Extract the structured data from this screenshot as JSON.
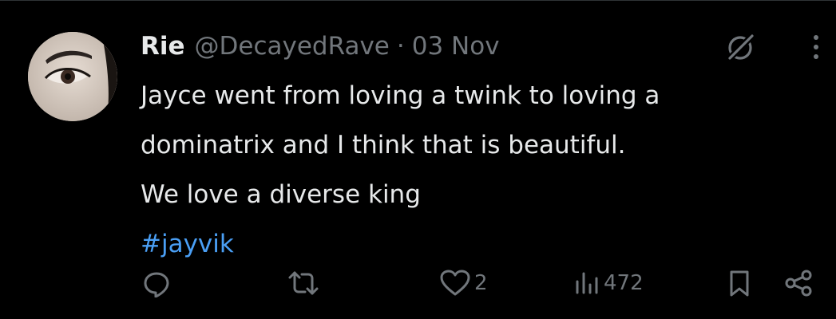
{
  "tweet": {
    "author": {
      "display_name": "Rie",
      "handle": "@DecayedRave"
    },
    "separator": "·",
    "date": "03 Nov",
    "text_lines": [
      "Jayce went from loving a twink to loving a",
      "dominatrix and I think that is beautiful.",
      "We love a diverse king"
    ],
    "hashtag": "#jayvik"
  },
  "actions": {
    "reply_count": "",
    "retweet_count": "",
    "like_count": "2",
    "views_count": "472"
  },
  "icons": {
    "header": [
      "grok-icon",
      "more-icon"
    ],
    "actions": [
      "reply-icon",
      "retweet-icon",
      "like-icon",
      "views-icon",
      "bookmark-icon",
      "share-icon"
    ]
  },
  "colors": {
    "background": "#000000",
    "text": "#e7e9ea",
    "muted": "#71767b",
    "link": "#4a9ff5"
  }
}
